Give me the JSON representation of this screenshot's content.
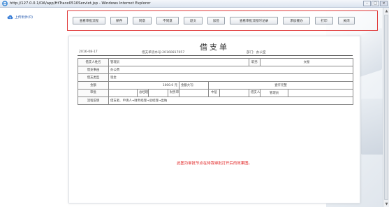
{
  "window": {
    "title": "http://127.0.0.1/OA/app/HtTrace0510Servlet.jsp - Windows Internet Explorer",
    "controls": [
      "–",
      "□",
      "×"
    ]
  },
  "sidebar": {
    "upload_label": "上传附件(0)",
    "upload_icon": "cloud-upload-icon"
  },
  "toolbar": {
    "buttons": [
      "查看审批流程",
      "保存",
      "同意",
      "不同意",
      "退文",
      "加签",
      "查看审批流程时记录",
      "添加催办",
      "打印",
      "关闭"
    ]
  },
  "document": {
    "title": "借支单",
    "date": "2016-08-17",
    "flow_no": "借支单流水号:20160817057",
    "dept": "部门：办公室",
    "rows": {
      "applicant_label": "借支人姓名",
      "applicant_value": "管理员",
      "position_label": "职务",
      "position_value": "文秘",
      "reason_label": "借支事由",
      "reason_value": "办公费",
      "type_label": "借支类型",
      "type_value": "现金",
      "amount_label": "金额",
      "amount_value": "1000.0 元",
      "amount_upper_label": "金额大写：",
      "amount_upper_value": "壹仟元整",
      "approve_label": "审批",
      "gm_label": "总经理",
      "finance_label": "财务审核",
      "mid_label": "中层",
      "borrower_label": "借支人",
      "borrower_value": "管理员",
      "flow_label": "流程说明",
      "flow_value": "借支者、申请人→财务经理→总经理→出纳"
    },
    "note": "此图为审批节点在待我审批打开后的效果图。"
  },
  "colors": {
    "accent": "#e03a3a",
    "link": "#2a5db0"
  }
}
